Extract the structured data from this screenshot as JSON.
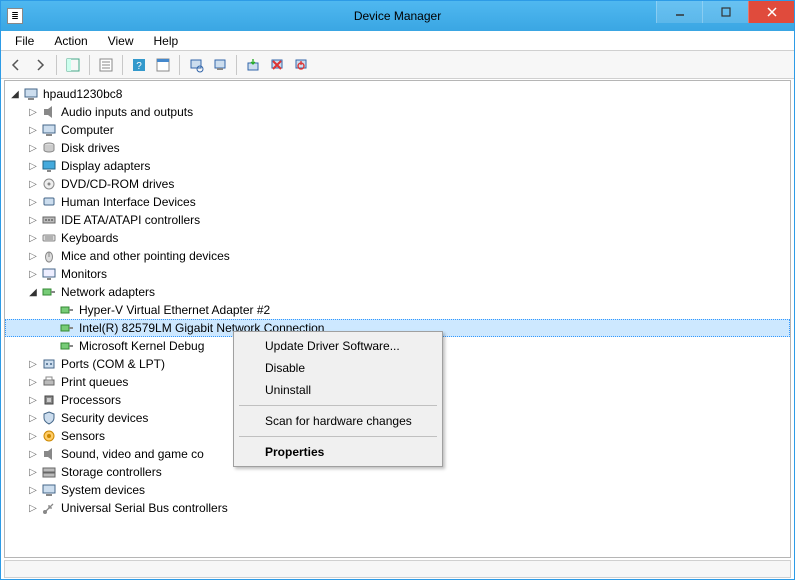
{
  "title": "Device Manager",
  "menus": {
    "file": "File",
    "action": "Action",
    "view": "View",
    "help": "Help"
  },
  "root": "hpaud1230bc8",
  "ctx": {
    "update": "Update Driver Software...",
    "disable": "Disable",
    "uninstall": "Uninstall",
    "scan": "Scan for hardware changes",
    "properties": "Properties"
  },
  "categories": [
    {
      "id": "audio",
      "label": "Audio inputs and outputs",
      "icon": "speaker"
    },
    {
      "id": "computer",
      "label": "Computer",
      "icon": "computer"
    },
    {
      "id": "disk",
      "label": "Disk drives",
      "icon": "disk"
    },
    {
      "id": "display",
      "label": "Display adapters",
      "icon": "display"
    },
    {
      "id": "dvd",
      "label": "DVD/CD-ROM drives",
      "icon": "dvd"
    },
    {
      "id": "hid",
      "label": "Human Interface Devices",
      "icon": "hid"
    },
    {
      "id": "ide",
      "label": "IDE ATA/ATAPI controllers",
      "icon": "ide"
    },
    {
      "id": "kbd",
      "label": "Keyboards",
      "icon": "keyboard"
    },
    {
      "id": "mice",
      "label": "Mice and other pointing devices",
      "icon": "mouse"
    },
    {
      "id": "monitors",
      "label": "Monitors",
      "icon": "monitor"
    },
    {
      "id": "net",
      "label": "Network adapters",
      "icon": "net",
      "expanded": true,
      "children": [
        {
          "id": "hyperv",
          "label": "Hyper-V Virtual Ethernet Adapter #2",
          "icon": "net"
        },
        {
          "id": "intel",
          "label": "Intel(R) 82579LM Gigabit Network Connection",
          "icon": "net",
          "selected": true,
          "ctx": true
        },
        {
          "id": "mskrnl",
          "label": "Microsoft Kernel Debug",
          "icon": "net",
          "truncated": true
        }
      ]
    },
    {
      "id": "ports",
      "label": "Ports (COM & LPT)",
      "icon": "port"
    },
    {
      "id": "printq",
      "label": "Print queues",
      "icon": "printer"
    },
    {
      "id": "proc",
      "label": "Processors",
      "icon": "cpu"
    },
    {
      "id": "sec",
      "label": "Security devices",
      "icon": "security"
    },
    {
      "id": "sensors",
      "label": "Sensors",
      "icon": "sensor"
    },
    {
      "id": "sound",
      "label": "Sound, video and game co",
      "icon": "speaker",
      "truncated": true
    },
    {
      "id": "storage",
      "label": "Storage controllers",
      "icon": "storage"
    },
    {
      "id": "sys",
      "label": "System devices",
      "icon": "system"
    },
    {
      "id": "usb",
      "label": "Universal Serial Bus controllers",
      "icon": "usb"
    }
  ]
}
